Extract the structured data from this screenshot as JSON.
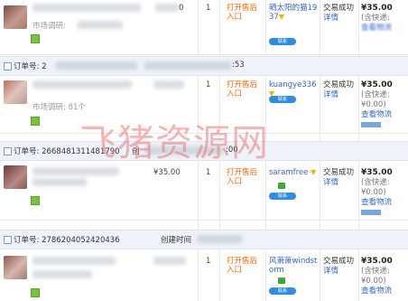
{
  "rows": [
    {
      "sub": "市场调研: ",
      "price": "",
      "qty": "1",
      "refund": "打开售后入口",
      "buyer": "晒太阳的猫1937",
      "status": "交易成功",
      "detail": "详情",
      "amount": "¥35.00",
      "fee": "(含快递:",
      "logistics": "查看物流"
    },
    {
      "order_label": "订单号: 2",
      "time_tail": ":53",
      "sub": "市场调研: 81个",
      "price": "",
      "qty": "1",
      "refund": "打开售后入口",
      "buyer": "kuangye336",
      "status": "交易成功",
      "detail": "详情",
      "amount": "¥35.00",
      "fee": "(含快递:¥0.00)",
      "logistics": "查看物流"
    },
    {
      "order_label": "订单号: 2668481311481790",
      "time_label": "创",
      "time_tail": ":00",
      "price": "¥35.00",
      "qty": "1",
      "refund": "打开售后入口",
      "buyer": "saramfree",
      "status": "交易成功",
      "detail": "详情",
      "amount": "¥35.00",
      "fee": "(含快递:¥0.00)",
      "logistics": "查看物流"
    },
    {
      "order_label": "订单号: 2786204052420436",
      "time_label": "创建时间",
      "price": "",
      "qty": "1",
      "refund": "打开售后入口",
      "buyer": "风萧萧windstorm",
      "status": "交易成功",
      "detail": "详情",
      "amount": "¥35.00",
      "fee": "(含快递:¥0.00)",
      "logistics": "查看物流"
    }
  ],
  "partial_top_price": "0",
  "watermark": "飞猪资源网",
  "colors": {
    "accent": "#3366cc",
    "refund": "#ff6600",
    "header_bg": "#eef3fa",
    "watermark": "#ec7878"
  },
  "icons": [
    "flag-icon",
    "chat-icon",
    "shop-badge-icon",
    "product-thumbnail"
  ]
}
